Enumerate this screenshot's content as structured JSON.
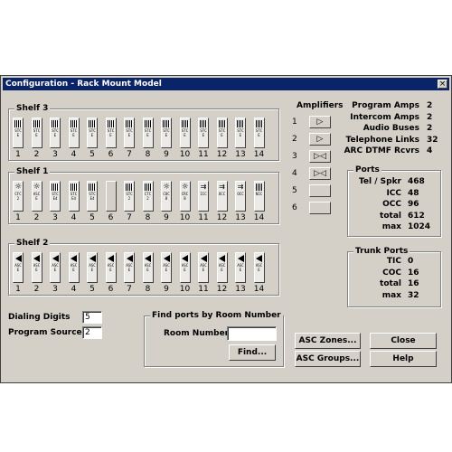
{
  "window": {
    "title": "Configuration - Rack Mount Model",
    "close_glyph": "×"
  },
  "shelves": [
    {
      "title": "Shelf 3",
      "cards": [
        {
          "num": "1",
          "icon": "lines",
          "label": "STC E"
        },
        {
          "num": "2",
          "icon": "lines",
          "label": "STC E"
        },
        {
          "num": "3",
          "icon": "lines",
          "label": "STC E"
        },
        {
          "num": "4",
          "icon": "lines",
          "label": "STC E"
        },
        {
          "num": "5",
          "icon": "lines",
          "label": "STC E"
        },
        {
          "num": "6",
          "icon": "lines",
          "label": "STC E"
        },
        {
          "num": "7",
          "icon": "lines",
          "label": "STC E"
        },
        {
          "num": "8",
          "icon": "lines",
          "label": "STC E"
        },
        {
          "num": "9",
          "icon": "lines",
          "label": "STC E"
        },
        {
          "num": "10",
          "icon": "lines",
          "label": "STC E"
        },
        {
          "num": "11",
          "icon": "lines",
          "label": "STC E"
        },
        {
          "num": "12",
          "icon": "lines",
          "label": "STC E"
        },
        {
          "num": "13",
          "icon": "lines",
          "label": "STC E"
        },
        {
          "num": "14",
          "icon": "lines",
          "label": "STC E"
        }
      ]
    },
    {
      "title": "Shelf 1",
      "cards": [
        {
          "num": "1",
          "icon": "star",
          "label": "CFC 2"
        },
        {
          "num": "2",
          "icon": "star",
          "label": "ASC E"
        },
        {
          "num": "3",
          "icon": "lines",
          "label": "STC E4"
        },
        {
          "num": "4",
          "icon": "lines",
          "label": "STC E4"
        },
        {
          "num": "5",
          "icon": "lines",
          "label": "STC E4"
        },
        {
          "num": "6",
          "icon": "empty",
          "label": ""
        },
        {
          "num": "7",
          "icon": "lines",
          "label": "STC 2"
        },
        {
          "num": "8",
          "icon": "lines",
          "label": "CTC 2"
        },
        {
          "num": "9",
          "icon": "star",
          "label": "COC 8"
        },
        {
          "num": "10",
          "icon": "star",
          "label": "CRC 8"
        },
        {
          "num": "11",
          "icon": "arrows",
          "label": "ICC"
        },
        {
          "num": "12",
          "icon": "arrows",
          "label": "OCC"
        },
        {
          "num": "13",
          "icon": "arrows",
          "label": "OCC"
        },
        {
          "num": "14",
          "icon": "lines",
          "label": "NIC"
        }
      ]
    },
    {
      "title": "Shelf 2",
      "cards": [
        {
          "num": "1",
          "icon": "speaker",
          "label": "ASC E"
        },
        {
          "num": "2",
          "icon": "speaker",
          "label": "ASC E"
        },
        {
          "num": "3",
          "icon": "speaker",
          "label": "ASC E"
        },
        {
          "num": "4",
          "icon": "speaker",
          "label": "ASC E"
        },
        {
          "num": "5",
          "icon": "speaker",
          "label": "ASC E"
        },
        {
          "num": "6",
          "icon": "speaker",
          "label": "ASC E"
        },
        {
          "num": "7",
          "icon": "speaker",
          "label": "ASC E"
        },
        {
          "num": "8",
          "icon": "speaker",
          "label": "ASC E"
        },
        {
          "num": "9",
          "icon": "speaker",
          "label": "ASC E"
        },
        {
          "num": "10",
          "icon": "speaker",
          "label": "ASC E"
        },
        {
          "num": "11",
          "icon": "speaker",
          "label": "ASC E"
        },
        {
          "num": "12",
          "icon": "speaker",
          "label": "ASC E"
        },
        {
          "num": "13",
          "icon": "speaker",
          "label": "ASC E"
        },
        {
          "num": "14",
          "icon": "speaker",
          "label": "ASC E"
        }
      ]
    }
  ],
  "amplifiers": {
    "title": "Amplifiers",
    "slots": [
      {
        "num": "1",
        "glyph": "▷"
      },
      {
        "num": "2",
        "glyph": "▷"
      },
      {
        "num": "3",
        "glyph": "▷◁"
      },
      {
        "num": "4",
        "glyph": "▷◁"
      },
      {
        "num": "5",
        "glyph": ""
      },
      {
        "num": "6",
        "glyph": ""
      }
    ]
  },
  "summary": [
    {
      "label": "Program Amps",
      "value": "2"
    },
    {
      "label": "Intercom Amps",
      "value": "2"
    },
    {
      "label": "Audio Buses",
      "value": "2"
    },
    {
      "label": "Telephone Links",
      "value": "32"
    },
    {
      "label": "ARC DTMF Rcvrs",
      "value": "4"
    }
  ],
  "ports": {
    "title": "Ports",
    "rows": [
      {
        "label": "Tel / Spkr",
        "value": "468"
      },
      {
        "label": "ICC",
        "value": "48"
      },
      {
        "label": "OCC",
        "value": "96"
      },
      {
        "label": "total",
        "value": "612"
      },
      {
        "label": "max",
        "value": "1024"
      }
    ]
  },
  "trunk_ports": {
    "title": "Trunk  Ports",
    "rows": [
      {
        "label": "TIC",
        "value": "0"
      },
      {
        "label": "COC",
        "value": "16"
      },
      {
        "label": "total",
        "value": "16"
      },
      {
        "label": "max",
        "value": "32"
      }
    ]
  },
  "dialing_digits": {
    "label": "Dialing Digits",
    "value": "5"
  },
  "program_sources": {
    "label": "Program Sources",
    "value": "2"
  },
  "find_ports": {
    "title": "Find ports by Room Number",
    "room_label": "Room Number",
    "room_value": "",
    "find_button": "Find..."
  },
  "buttons": {
    "asc_zones": "ASC Zones...",
    "asc_groups": "ASC Groups...",
    "close": "Close",
    "help": "Help"
  }
}
